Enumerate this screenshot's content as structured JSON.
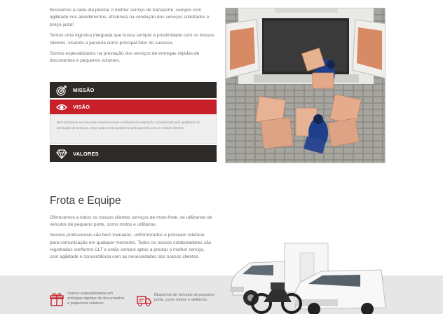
{
  "intro": {
    "p1": "Buscamos a cada dia prestar o melhor serviço de transporte, sempre com agilidade nos atendimentos, eficiência na condução dos serviços solicitados e preço justo!",
    "p2": "Temos uma logística integrada que busca sempre a proximidade com os nossos clientes, visando a parceria como principal fator do sucesso.",
    "p3": "Somos especializados na prestação dos serviços de entregas rápidas de documentos e pequenos volumes."
  },
  "accordion": {
    "missao": {
      "label": "MISSÃO",
      "icon": "target-icon"
    },
    "visao": {
      "label": "VISÃO",
      "icon": "eye-icon",
      "text": "Nos tornarmos em uma das empresas mais confiáveis do segmento, reconhecida pela qualidade na prestação de serviços, preço justo e principalmente pela parceria com os nossos clientes."
    },
    "valores": {
      "label": "VALORES",
      "icon": "diamond-icon"
    }
  },
  "frota": {
    "title": "Frota e Equipe",
    "p1": "Oferecemos a todos os nossos clientes serviços de moto-frete, se utilizando de veículos de pequeno porte, como motos e utilitários.",
    "p2": "Nossos profissionais são bem treinados, uniformizados e possuem telefone para comunicação em qualquer momento. Todos os nossos colaboradores são registrados conforme CLT e estão sempre aptos a prestar o melhor serviço, com agilidade e concordância com as necessidades dos nossos clientes."
  },
  "features": [
    {
      "icon": "gift-box-icon",
      "text": "Somos especializados em entregas rápidas de documentos e pequenos volumes."
    },
    {
      "icon": "delivery-truck-icon",
      "text": "Dispomos de veículos de pequeno porte, como motos e utilitários."
    }
  ],
  "colors": {
    "dark": "#2d2a27",
    "accent": "#c8202a",
    "band": "#e6e6e6"
  }
}
